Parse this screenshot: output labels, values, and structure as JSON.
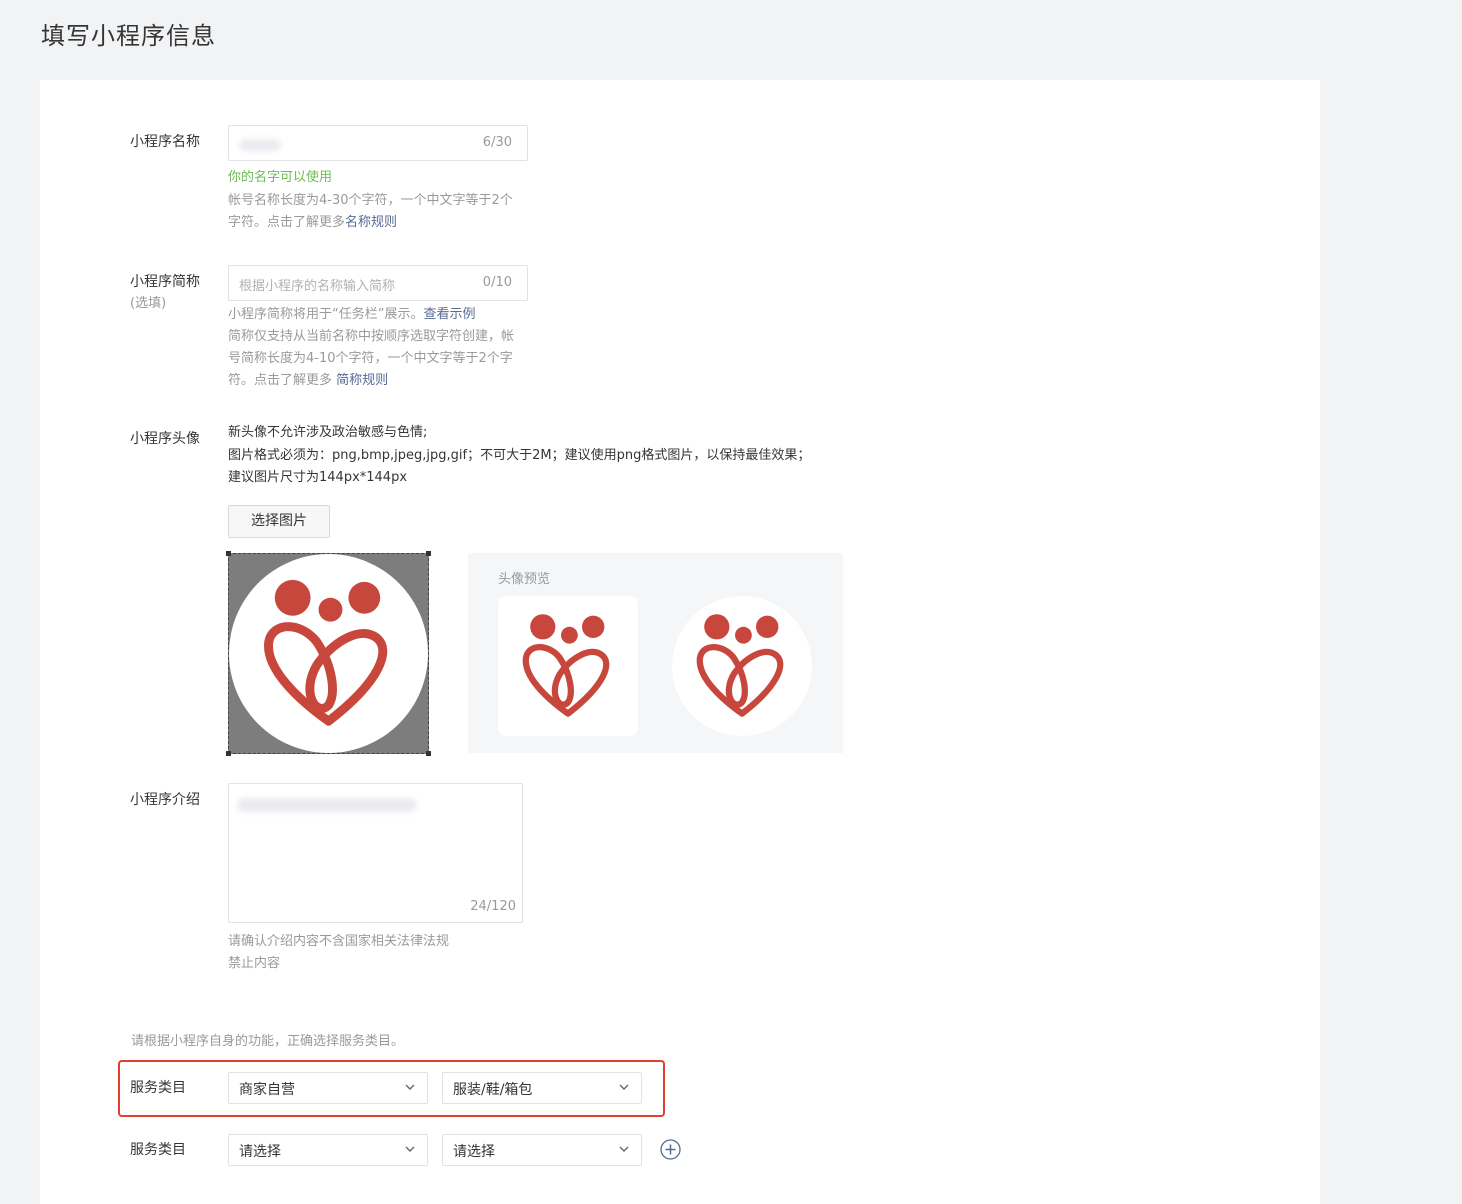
{
  "page_title": "填写小程序信息",
  "name": {
    "label": "小程序名称",
    "counter": "6/30",
    "ok_text": "你的名字可以使用",
    "hint": "帐号名称长度为4-30个字符，一个中文字等于2个字符。点击了解更多",
    "hint_link": "名称规则"
  },
  "short_name": {
    "label": "小程序简称",
    "optional": "(选填)",
    "placeholder": "根据小程序的名称输入简称",
    "counter": "0/10",
    "hint1": "小程序简称将用于“任务栏”展示。",
    "hint1_link": "查看示例",
    "hint2": "简称仅支持从当前名称中按顺序选取字符创建，帐号简称长度为4-10个字符，一个中文字等于2个字符。点击了解更多 ",
    "hint2_link": "简称规则"
  },
  "avatar": {
    "label": "小程序头像",
    "desc1": "新头像不允许涉及政治敏感与色情;",
    "desc2": "图片格式必须为：png,bmp,jpeg,jpg,gif；不可大于2M；建议使用png格式图片，以保持最佳效果；",
    "desc3": "建议图片尺寸为144px*144px",
    "button": "选择图片",
    "preview_title": "头像预览",
    "logo_color": "#c8473c"
  },
  "intro": {
    "label": "小程序介绍",
    "counter": "24/120",
    "hint1": "请确认介绍内容不含国家相关法律法规",
    "hint2": "禁止内容"
  },
  "category": {
    "hint": "请根据小程序自身的功能，正确选择服务类目。",
    "row1": {
      "label": "服务类目",
      "first": "商家自营",
      "second": "服装/鞋/箱包"
    },
    "row2": {
      "label": "服务类目",
      "first": "请选择",
      "second": "请选择"
    },
    "highlight_color": "#e0402d"
  }
}
